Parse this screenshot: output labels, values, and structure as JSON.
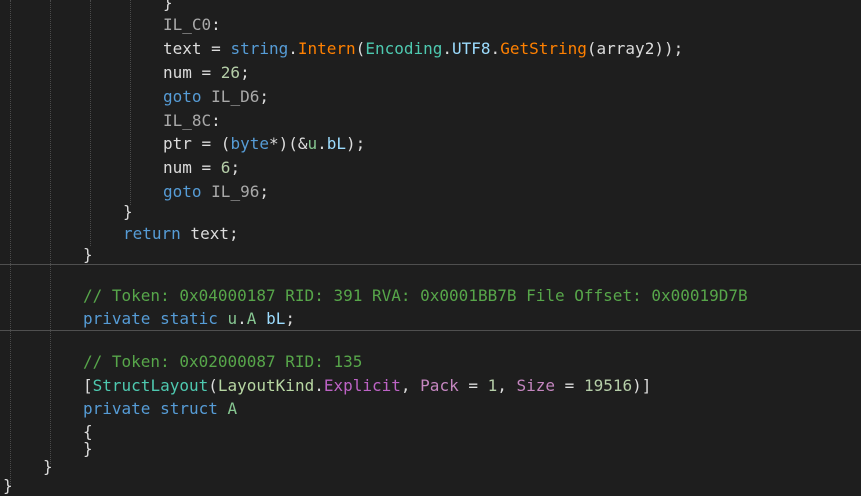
{
  "lines": [
    {
      "tokens": [
        {
          "t": "}",
          "c": "pun"
        }
      ]
    },
    {
      "tokens": [
        {
          "t": "IL_C0",
          "c": "lbl"
        },
        {
          "t": ":",
          "c": "pun"
        }
      ]
    },
    {
      "tokens": [
        {
          "t": "text = ",
          "c": "pun"
        },
        {
          "t": "string",
          "c": "kw"
        },
        {
          "t": ".",
          "c": "pun"
        },
        {
          "t": "Intern",
          "c": "mth"
        },
        {
          "t": "(",
          "c": "pun"
        },
        {
          "t": "Encoding",
          "c": "typ"
        },
        {
          "t": ".",
          "c": "pun"
        },
        {
          "t": "UTF8",
          "c": "fld"
        },
        {
          "t": ".",
          "c": "pun"
        },
        {
          "t": "GetString",
          "c": "mth"
        },
        {
          "t": "(array2));",
          "c": "pun"
        }
      ]
    },
    {
      "tokens": [
        {
          "t": "num = ",
          "c": "pun"
        },
        {
          "t": "26",
          "c": "num"
        },
        {
          "t": ";",
          "c": "pun"
        }
      ]
    },
    {
      "tokens": [
        {
          "t": "goto",
          "c": "kw"
        },
        {
          "t": " ",
          "c": "pun"
        },
        {
          "t": "IL_D6",
          "c": "lbl"
        },
        {
          "t": ";",
          "c": "pun"
        }
      ]
    },
    {
      "tokens": [
        {
          "t": "IL_8C",
          "c": "lbl"
        },
        {
          "t": ":",
          "c": "pun"
        }
      ]
    },
    {
      "tokens": [
        {
          "t": "ptr = (",
          "c": "pun"
        },
        {
          "t": "byte",
          "c": "kw"
        },
        {
          "t": "*)(&",
          "c": "pun"
        },
        {
          "t": "u",
          "c": "stru"
        },
        {
          "t": ".",
          "c": "pun"
        },
        {
          "t": "bL",
          "c": "fld"
        },
        {
          "t": ");",
          "c": "pun"
        }
      ]
    },
    {
      "tokens": [
        {
          "t": "num = ",
          "c": "pun"
        },
        {
          "t": "6",
          "c": "num"
        },
        {
          "t": ";",
          "c": "pun"
        }
      ]
    },
    {
      "tokens": [
        {
          "t": "goto",
          "c": "kw"
        },
        {
          "t": " ",
          "c": "pun"
        },
        {
          "t": "IL_96",
          "c": "lbl"
        },
        {
          "t": ";",
          "c": "pun"
        }
      ]
    },
    {
      "tokens": [
        {
          "t": "}",
          "c": "pun"
        }
      ]
    },
    {
      "tokens": [
        {
          "t": "return",
          "c": "kw"
        },
        {
          "t": " text;",
          "c": "pun"
        }
      ]
    },
    {
      "tokens": [
        {
          "t": "}",
          "c": "pun"
        }
      ]
    },
    {
      "tokens": [
        {
          "t": "// Token: 0x04000187 RID: 391 RVA: 0x0001BB7B File Offset: 0x00019D7B",
          "c": "cmt"
        }
      ]
    },
    {
      "tokens": [
        {
          "t": "private",
          "c": "kw"
        },
        {
          "t": " ",
          "c": "pun"
        },
        {
          "t": "static",
          "c": "kw"
        },
        {
          "t": " ",
          "c": "pun"
        },
        {
          "t": "u",
          "c": "stru"
        },
        {
          "t": ".",
          "c": "pun"
        },
        {
          "t": "A",
          "c": "stru"
        },
        {
          "t": " ",
          "c": "pun"
        },
        {
          "t": "bL",
          "c": "fld"
        },
        {
          "t": ";",
          "c": "pun"
        }
      ]
    },
    {
      "tokens": [
        {
          "t": "// Token: 0x02000087 RID: 135",
          "c": "cmt"
        }
      ]
    },
    {
      "tokens": [
        {
          "t": "[",
          "c": "pun"
        },
        {
          "t": "StructLayout",
          "c": "typ"
        },
        {
          "t": "(",
          "c": "pun"
        },
        {
          "t": "LayoutKind",
          "c": "enm"
        },
        {
          "t": ".",
          "c": "pun"
        },
        {
          "t": "Explicit",
          "c": "enmv"
        },
        {
          "t": ", ",
          "c": "pun"
        },
        {
          "t": "Pack",
          "c": "prop"
        },
        {
          "t": " = ",
          "c": "pun"
        },
        {
          "t": "1",
          "c": "num"
        },
        {
          "t": ", ",
          "c": "pun"
        },
        {
          "t": "Size",
          "c": "prop"
        },
        {
          "t": " = ",
          "c": "pun"
        },
        {
          "t": "19516",
          "c": "num"
        },
        {
          "t": ")]",
          "c": "pun"
        }
      ]
    },
    {
      "tokens": [
        {
          "t": "private",
          "c": "kw"
        },
        {
          "t": " ",
          "c": "pun"
        },
        {
          "t": "struct",
          "c": "kw"
        },
        {
          "t": " ",
          "c": "pun"
        },
        {
          "t": "A",
          "c": "stru"
        }
      ]
    },
    {
      "tokens": [
        {
          "t": "{",
          "c": "pun"
        }
      ]
    },
    {
      "tokens": [
        {
          "t": "}",
          "c": "pun"
        }
      ]
    },
    {
      "tokens": [
        {
          "t": "}",
          "c": "pun"
        }
      ]
    },
    {
      "tokens": [
        {
          "t": "}",
          "c": "pun"
        }
      ]
    }
  ],
  "colors": {
    "background": "#1e1e1e",
    "keyword": "#569cd6",
    "label": "#a9a9a9",
    "type": "#4ec9b0",
    "method": "#ff8000",
    "comment": "#57a64a",
    "number": "#b5cea8",
    "separator": "#4f4f4f"
  }
}
